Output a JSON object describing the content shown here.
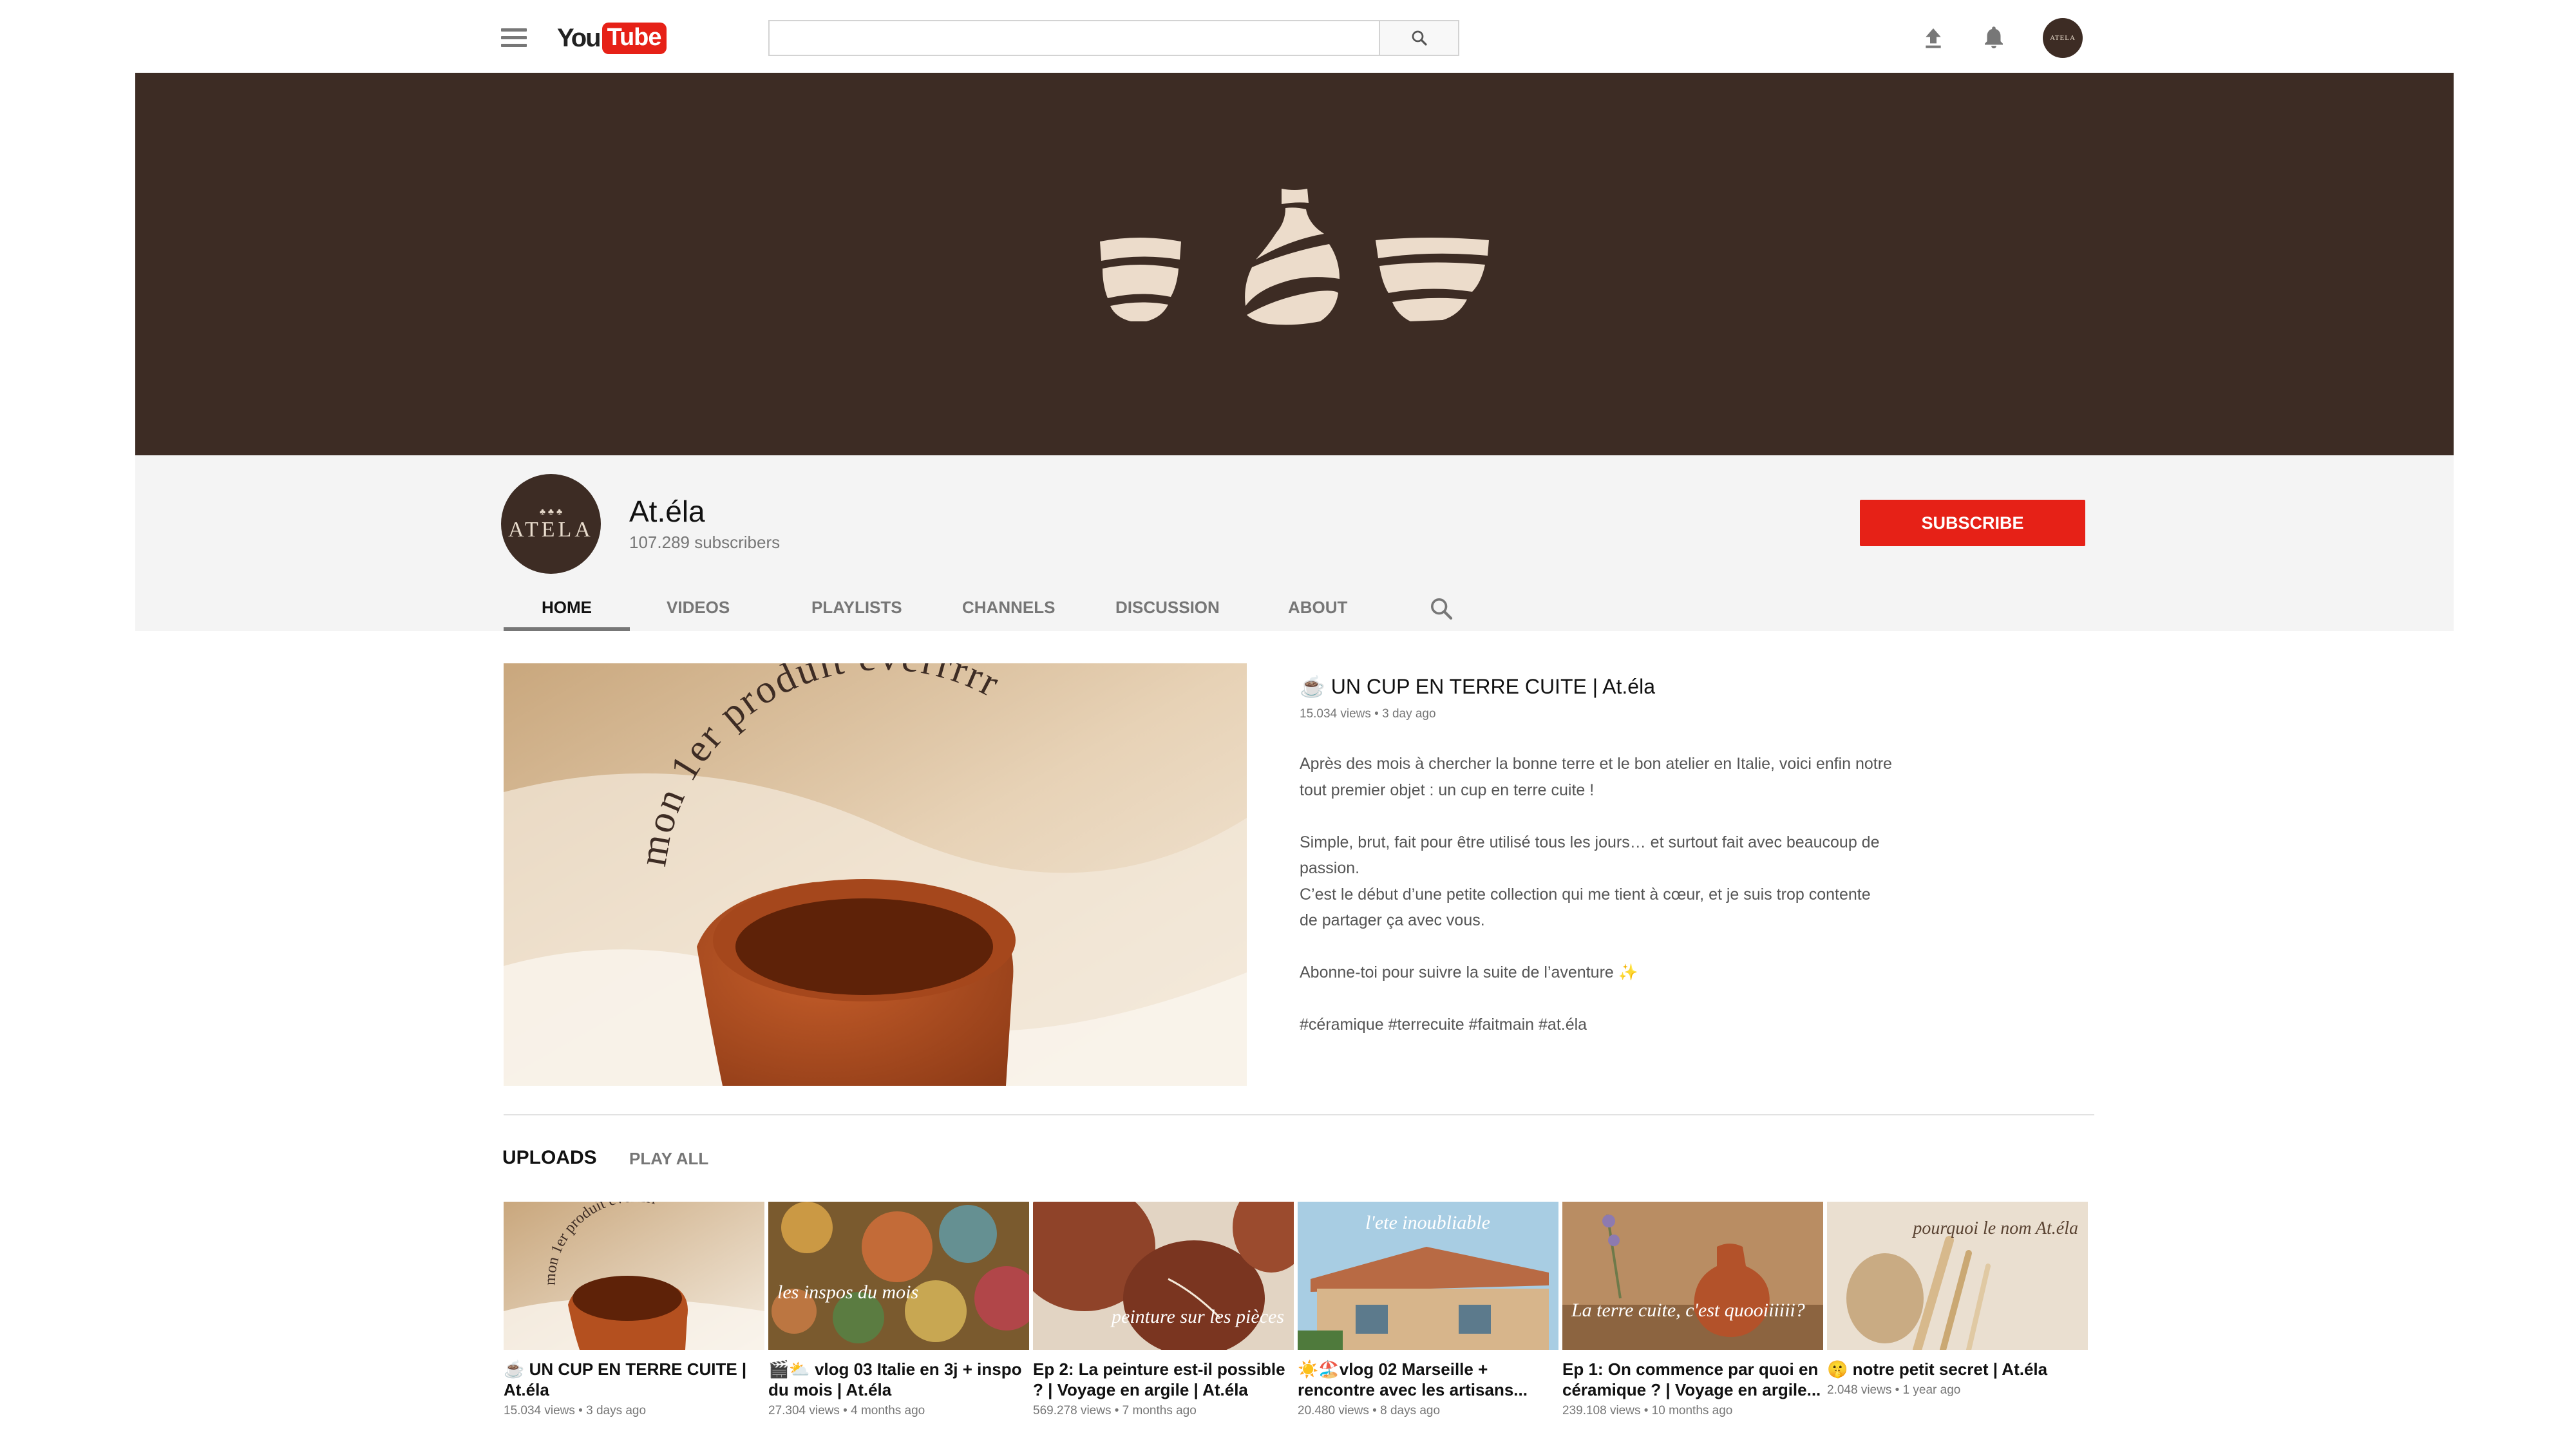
{
  "topbar": {
    "logo_you": "You",
    "logo_tube": "Tube",
    "search_placeholder": "",
    "avatar_text": "ATELA",
    "icons": [
      "menu-icon",
      "search-icon",
      "upload-icon",
      "bell-icon"
    ]
  },
  "channel": {
    "avatar_mark": "♣ ♣ ♣",
    "avatar_name": "ATELA",
    "name": "At.éla",
    "subscribers": "107.289 subscribers",
    "subscribe_label": "SUBSCRIBE",
    "colors": {
      "banner": "#3d2c24",
      "subscribe": "#e62117",
      "pottery": "#ecdccb"
    }
  },
  "tabs": [
    {
      "label": "HOME",
      "active": true
    },
    {
      "label": "VIDEOS",
      "active": false
    },
    {
      "label": "PLAYLISTS",
      "active": false
    },
    {
      "label": "CHANNELS",
      "active": false
    },
    {
      "label": "DISCUSSION",
      "active": false
    },
    {
      "label": "ABOUT",
      "active": false
    }
  ],
  "featured": {
    "thumb_text": "mon 1er produit everrrrr",
    "title": "☕ UN CUP EN TERRE CUITE | At.éla",
    "meta": "15.034 views • 3 day ago",
    "description": [
      "Après des mois à chercher la bonne terre et le bon atelier en Italie, voici enfin notre",
      "tout premier objet : un cup en terre cuite !",
      "",
      "Simple, brut, fait pour être utilisé tous les jours… et surtout fait avec beaucoup de",
      "passion.",
      "C’est le début d’une petite collection qui me tient à cœur, et je suis trop contente",
      "de partager ça avec vous.",
      "",
      "Abonne-toi pour suivre la suite de l’aventure ✨",
      "",
      "#céramique #terrecuite #faitmain #at.éla"
    ]
  },
  "uploads": {
    "title": "UPLOADS",
    "play_all": "PLAY ALL",
    "videos": [
      {
        "thumb_text": "mon 1er produit everrrrr",
        "title": "☕ UN CUP EN TERRE CUITE | At.éla",
        "meta": "15.034 views • 3 days ago"
      },
      {
        "thumb_text": "les inspos du mois",
        "title": "🎬⛅ vlog 03 Italie en 3j + inspo du mois | At.éla",
        "meta": "27.304 views • 4 months ago"
      },
      {
        "thumb_text": "peinture sur les pièces",
        "title": "Ep 2: La peinture est-il possible ? | Voyage en argile | At.éla",
        "meta": "569.278 views • 7 months ago"
      },
      {
        "thumb_text": "l'ete inoubliable",
        "title": "☀️🏖️vlog 02 Marseille + rencontre avec les artisans...",
        "meta": "20.480 views • 8 days ago"
      },
      {
        "thumb_text": "La terre cuite, c'est quooiiiiii?",
        "title": "Ep 1: On commence par quoi en céramique ? | Voyage en argile...",
        "meta": "239.108 views • 10 months ago"
      },
      {
        "thumb_text": "pourquoi le nom At.éla",
        "title": "🤫 notre petit secret | At.éla",
        "meta": "2.048 views • 1 year ago"
      }
    ]
  }
}
